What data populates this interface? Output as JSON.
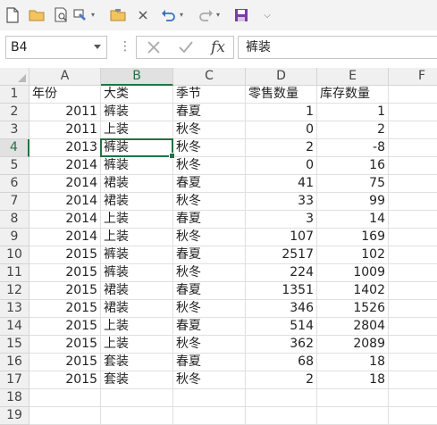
{
  "toolbar": {
    "icons": [
      "new-file-icon",
      "open-folder-icon",
      "print-preview-icon",
      "format-painter-icon",
      "paste-icon",
      "close-icon",
      "undo-icon",
      "redo-icon",
      "save-icon",
      "customize-icon"
    ],
    "customize_glyph": "⌵"
  },
  "formula_bar": {
    "name_box": "B4",
    "content": "裤装",
    "fx_label": "fx"
  },
  "colors": {
    "accent": "#217346",
    "header_bg": "#f0f0f0"
  },
  "columns": [
    "A",
    "B",
    "C",
    "D",
    "E",
    "F"
  ],
  "selected": {
    "column": "B",
    "row": 4
  },
  "rows": [
    {
      "n": "1",
      "cells": [
        "年份",
        "大类",
        "季节",
        "零售数量",
        "库存数量",
        ""
      ]
    },
    {
      "n": "2",
      "cells": [
        "2011",
        "裤装",
        "春夏",
        "1",
        "1",
        ""
      ]
    },
    {
      "n": "3",
      "cells": [
        "2011",
        "上装",
        "秋冬",
        "0",
        "2",
        ""
      ]
    },
    {
      "n": "4",
      "cells": [
        "2013",
        "裤装",
        "秋冬",
        "2",
        "-8",
        ""
      ]
    },
    {
      "n": "5",
      "cells": [
        "2014",
        "裤装",
        "秋冬",
        "0",
        "16",
        ""
      ]
    },
    {
      "n": "6",
      "cells": [
        "2014",
        "裙装",
        "春夏",
        "41",
        "75",
        ""
      ]
    },
    {
      "n": "7",
      "cells": [
        "2014",
        "裙装",
        "秋冬",
        "33",
        "99",
        ""
      ]
    },
    {
      "n": "8",
      "cells": [
        "2014",
        "上装",
        "春夏",
        "3",
        "14",
        ""
      ]
    },
    {
      "n": "9",
      "cells": [
        "2014",
        "上装",
        "秋冬",
        "107",
        "169",
        ""
      ]
    },
    {
      "n": "10",
      "cells": [
        "2015",
        "裤装",
        "春夏",
        "2517",
        "102",
        ""
      ]
    },
    {
      "n": "11",
      "cells": [
        "2015",
        "裤装",
        "秋冬",
        "224",
        "1009",
        ""
      ]
    },
    {
      "n": "12",
      "cells": [
        "2015",
        "裙装",
        "春夏",
        "1351",
        "1402",
        ""
      ]
    },
    {
      "n": "13",
      "cells": [
        "2015",
        "裙装",
        "秋冬",
        "346",
        "1526",
        ""
      ]
    },
    {
      "n": "14",
      "cells": [
        "2015",
        "上装",
        "春夏",
        "514",
        "2804",
        ""
      ]
    },
    {
      "n": "15",
      "cells": [
        "2015",
        "上装",
        "秋冬",
        "362",
        "2089",
        ""
      ]
    },
    {
      "n": "16",
      "cells": [
        "2015",
        "套装",
        "春夏",
        "68",
        "18",
        ""
      ]
    },
    {
      "n": "17",
      "cells": [
        "2015",
        "套装",
        "秋冬",
        "2",
        "18",
        ""
      ]
    },
    {
      "n": "18",
      "cells": [
        "",
        "",
        "",
        "",
        "",
        ""
      ]
    },
    {
      "n": "19",
      "cells": [
        "",
        "",
        "",
        "",
        "",
        ""
      ]
    }
  ]
}
